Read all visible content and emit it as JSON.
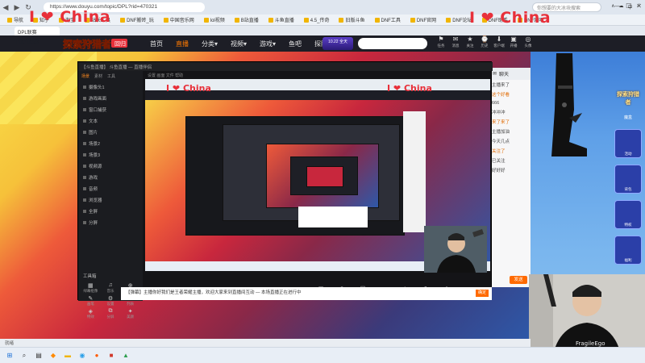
{
  "browser": {
    "url": "https://www.douyu.com/topic/DPL?rid=470321",
    "search_placeholder": "你想要的大冰块搜索",
    "watermark": "I ❤ China",
    "tab_title": "DPL联赛",
    "bookmarks": [
      "导航",
      "知乎",
      "淘宝",
      "站长工具",
      "DNF搬砖_玩",
      "中国音乐网",
      "lol视频",
      "B站直播",
      "斗鱼直播",
      "4.5_传奇",
      "旧版斗鱼",
      "DNF工具",
      "DNF官网",
      "DNF论坛",
      "DNF助手",
      "DNF网吧"
    ]
  },
  "site": {
    "room_id": "107053",
    "logo_text": "探索狩猎者",
    "logo_badge": "回归",
    "nav": [
      {
        "label": "首页",
        "active": false
      },
      {
        "label": "直播",
        "active": true
      },
      {
        "label": "分类▾",
        "active": false
      },
      {
        "label": "视频▾",
        "active": false
      },
      {
        "label": "游戏▾",
        "active": false
      },
      {
        "label": "鱼吧",
        "active": false
      },
      {
        "label": "探险者乐园",
        "active": false
      }
    ],
    "promo": "10.22 全天",
    "header_icons": [
      {
        "icon": "⚑",
        "label": "任务"
      },
      {
        "icon": "✉",
        "label": "消息"
      },
      {
        "icon": "★",
        "label": "关注"
      },
      {
        "icon": "⌚",
        "label": "历史"
      },
      {
        "icon": "⬇",
        "label": "客户端"
      },
      {
        "icon": "▣",
        "label": "开播"
      },
      {
        "icon": "◎",
        "label": "头像"
      }
    ]
  },
  "sidepanel": {
    "brand_title": "探索狩猎者",
    "brand_sub": "魔盒",
    "badges": [
      "活动",
      "背包",
      "特权",
      "福利"
    ]
  },
  "chat": {
    "title": "聊天",
    "lines": [
      "主播来了",
      "这个好看",
      "666",
      "冲冲冲",
      "来了来了",
      "主播加油",
      "今天几点",
      "关注了",
      "已关注",
      "好好好"
    ],
    "send": "发送"
  },
  "obs": {
    "title": "【斗鱼直播】 斗鱼直播 — 直播伴侣",
    "toolbar": "设置  画面  文件  帮助",
    "tabs": [
      "场景",
      "素材",
      "工具"
    ],
    "scenes": [
      "摄像头1",
      "游戏画面",
      "窗口捕获",
      "文本",
      "图片",
      "场景2",
      "场景3",
      "视频源",
      "游戏",
      "音频",
      "浏览器",
      "全屏",
      "分屏"
    ],
    "tools_title": "工具箱",
    "tools": [
      {
        "icon": "▦",
        "label": "绿幕抠像"
      },
      {
        "icon": "♫",
        "label": "音乐"
      },
      {
        "icon": "⊕",
        "label": "主播工具"
      },
      {
        "icon": "✎",
        "label": "画笔"
      },
      {
        "icon": "⚙",
        "label": "设置"
      },
      {
        "icon": "☰",
        "label": "列表"
      },
      {
        "icon": "◈",
        "label": "特效"
      },
      {
        "icon": "⧉",
        "label": "分屏"
      },
      {
        "icon": "✦",
        "label": "美颜"
      }
    ],
    "bottom_buttons": [
      {
        "icon": "▣",
        "label": "游戏"
      },
      {
        "icon": "⊙",
        "label": "摄像头"
      },
      {
        "icon": "☐",
        "label": "窗口"
      },
      {
        "icon": "▭",
        "label": "全屏"
      },
      {
        "icon": "♪",
        "label": "麦克风"
      },
      {
        "icon": "♬",
        "label": "扬声器"
      },
      {
        "icon": "●",
        "label": "录制"
      }
    ],
    "live_button": "开始直播"
  },
  "notice": {
    "text": "【弹幕】主播你好我们是王者荣耀主播，欢迎大家来到直播间互动 — 本场直播正在进行中",
    "ok": "确定"
  },
  "statusbar": "就绪",
  "taskbar": {
    "icons": [
      {
        "icon": "⊞",
        "color": "#1a6fd6",
        "name": "start"
      },
      {
        "icon": "⌕",
        "color": "#333",
        "name": "search"
      },
      {
        "icon": "▤",
        "color": "#333",
        "name": "taskview"
      },
      {
        "icon": "◆",
        "color": "#ff8a00",
        "name": "app-1"
      },
      {
        "icon": "▬",
        "color": "#f0b400",
        "name": "explorer"
      },
      {
        "icon": "◉",
        "color": "#2aa0e8",
        "name": "browser"
      },
      {
        "icon": "●",
        "color": "#ff5a00",
        "name": "app-2"
      },
      {
        "icon": "■",
        "color": "#d0392b",
        "name": "app-3"
      },
      {
        "icon": "▲",
        "color": "#2e9f4f",
        "name": "app-4"
      }
    ],
    "tray": [
      "∧",
      "☁",
      "中",
      "♫"
    ]
  }
}
